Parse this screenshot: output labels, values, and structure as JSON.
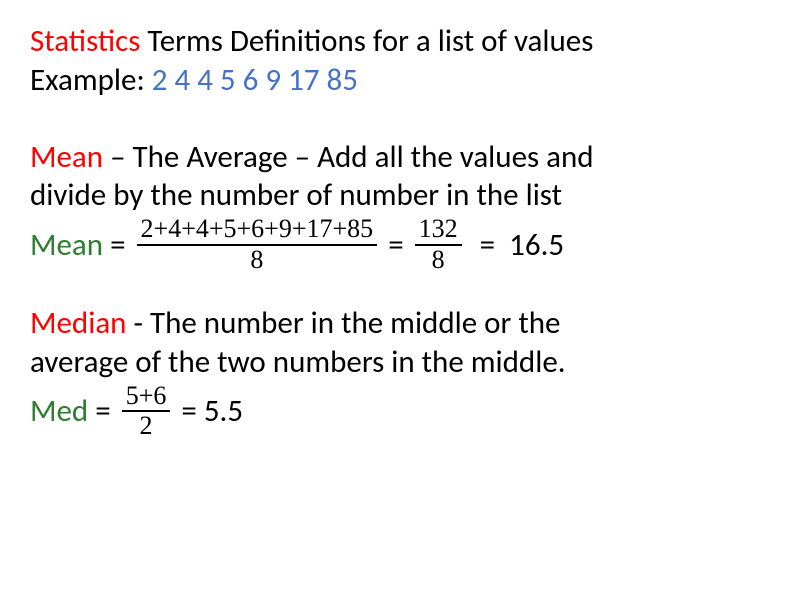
{
  "title": {
    "word1": "Statistics",
    "rest": " Terms Definitions for a list of values"
  },
  "example": {
    "label": " Example: ",
    "values": "2 4 4 5 6 9 17 85"
  },
  "mean": {
    "term": "Mean",
    "def1": " – The Average – Add all the values and",
    "def2": "divide by the number of number in the list",
    "eq_label": "Mean ",
    "eq_eq1": "= ",
    "frac1_num": "2+4+4+5+6+9+17+85",
    "frac1_den": "8",
    "eq_eq2": " = ",
    "frac2_num": "132",
    "frac2_den": "8",
    "eq_eq3": "  =  ",
    "result": "16.5"
  },
  "median": {
    "term": "Median",
    "def1": " -  The number in the middle or the",
    "def2": "average of the two numbers in the middle.",
    "eq_label": "Med ",
    "eq_eq1": "= ",
    "frac_num": "5+6",
    "frac_den": "2",
    "eq_eq2": " = ",
    "result": "5.5"
  },
  "chart_data": {
    "type": "table",
    "dataset": [
      2,
      4,
      4,
      5,
      6,
      9,
      17,
      85
    ],
    "computed": {
      "sum": 132,
      "count": 8,
      "mean": 16.5,
      "median_pair": [
        5,
        6
      ],
      "median": 5.5
    }
  }
}
